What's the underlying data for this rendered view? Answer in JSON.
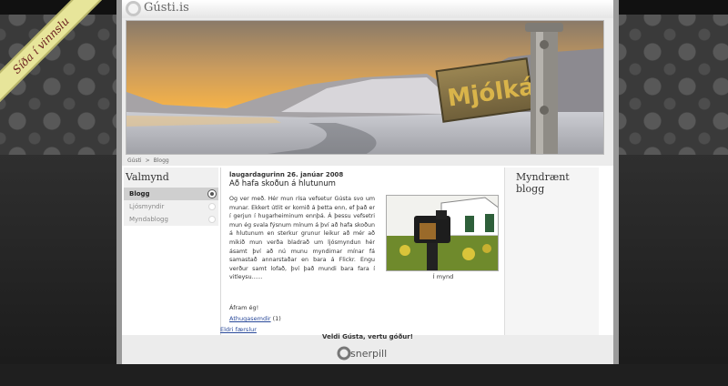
{
  "ribbon": {
    "text": "Síða í vinnslu"
  },
  "header": {
    "site_title": "Gústi.is",
    "banner_sign_text": "Mjólká"
  },
  "breadcrumb": [
    "Gústi",
    ">",
    "Blogg"
  ],
  "nav": {
    "heading": "Valmynd",
    "items": [
      {
        "label": "Blogg",
        "active": true
      },
      {
        "label": "Ljósmyndir",
        "active": false
      },
      {
        "label": "Myndablogg",
        "active": false
      }
    ]
  },
  "post": {
    "date": "laugardagurinn 26. janúar 2008",
    "title": "Að hafa skoðun á hlutunum",
    "body": "Og ver með. Hér mun rísa vefsetur Gústa svo um munar. Ekkert útlit er komið á þetta enn, ef það er í gerjun í hugarheiminum ennþá. Á þessu vefsetri mun ég svala fýsnum mínum á því að hafa skoðun á hlutunum en sterkur grunur leikur að mér að mikið mun verða bladrað um ljósmyndun hér ásamt því að nú munu myndirnar mínar fá samastað annarstaðar en bara á Flickr. Engu verður samt lofað, því það mundi bara fara í vitleysu......",
    "photo_caption": "Í mynd",
    "sign_off": "Áfram ég!",
    "comments_label": "Athugasemdir",
    "comments_count": "(1)"
  },
  "older_posts": "Eldri færslur",
  "right": {
    "heading": "Myndrænt blogg"
  },
  "footer": {
    "text": "Veldi Gústa, vertu góður!",
    "logo_text": "snerpill"
  }
}
